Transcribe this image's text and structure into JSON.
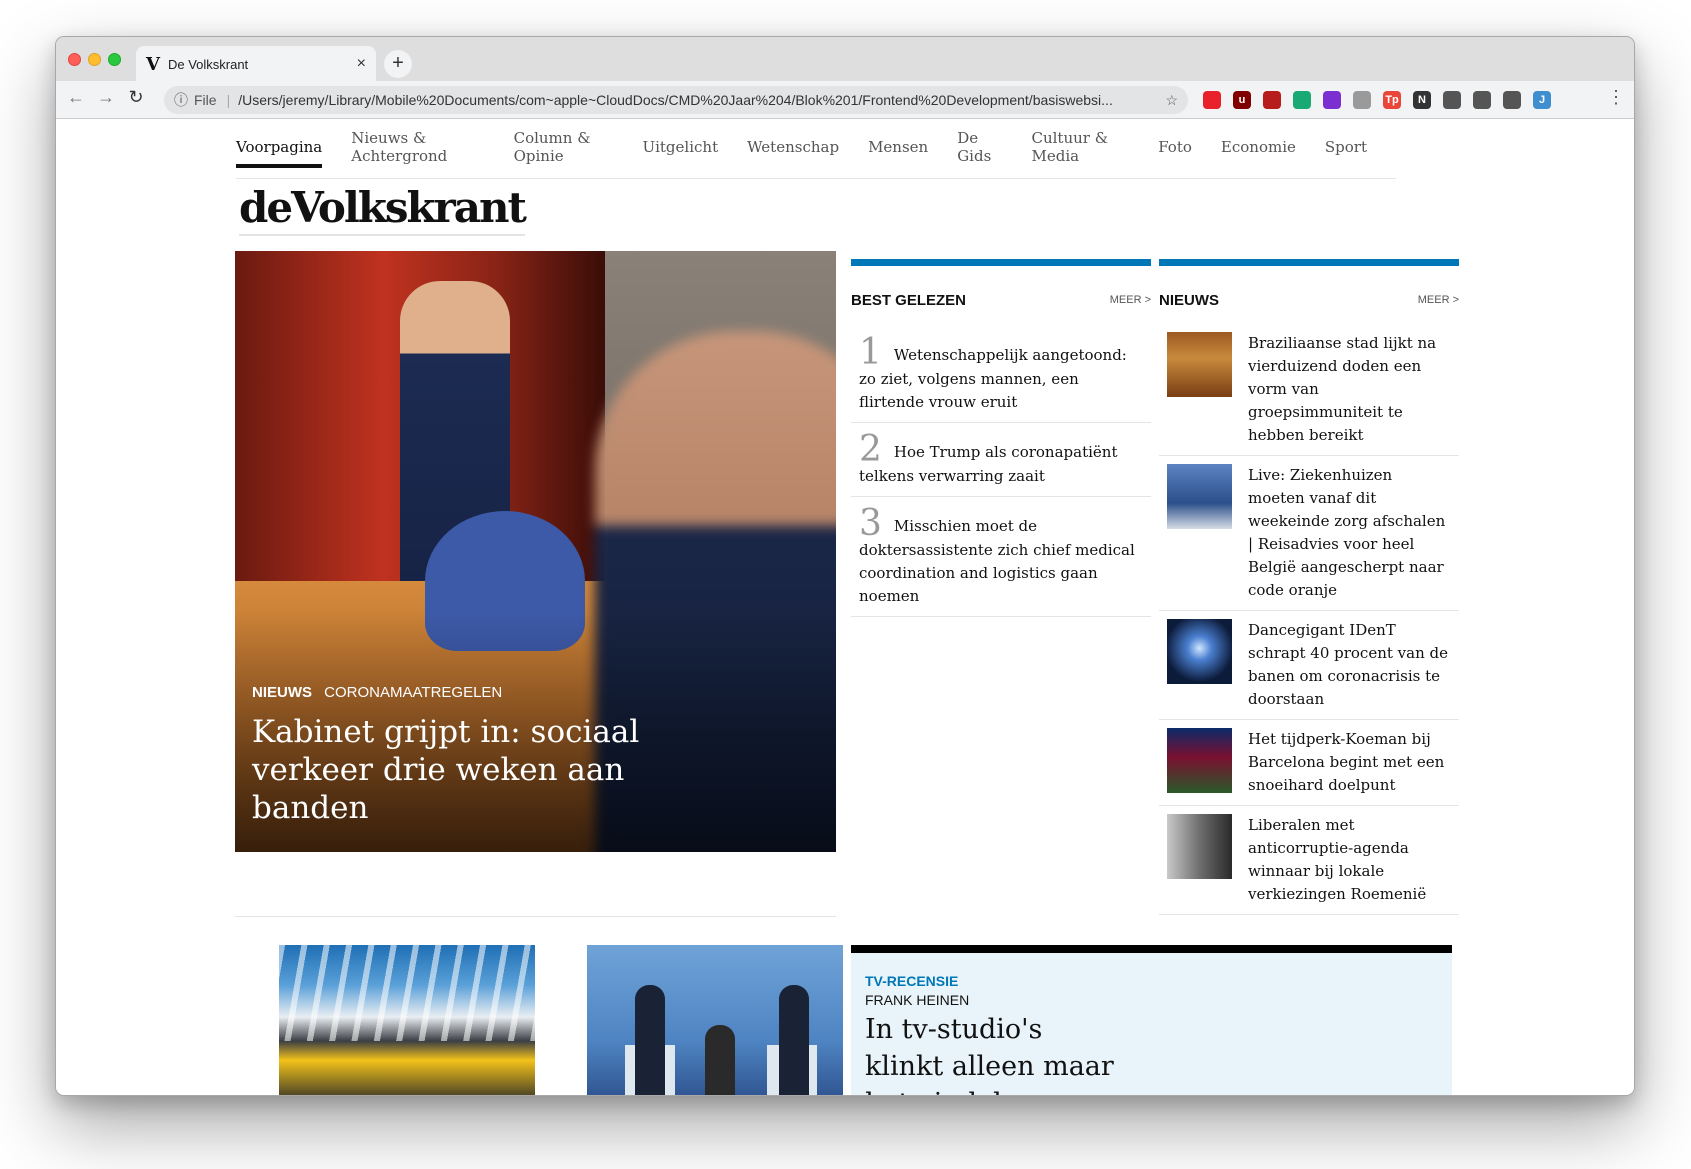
{
  "browser": {
    "tab_favicon": "V",
    "tab_title": "De Volkskrant",
    "tab_close": "×",
    "new_tab": "+",
    "back_icon": "←",
    "forward_icon": "→",
    "reload_icon": "↻",
    "info_icon": "ⓘ",
    "file_label": "File",
    "url": "/Users/jeremy/Library/Mobile%20Documents/com~apple~CloudDocs/CMD%20Jaar%204/Blok%201/Frontend%20Development/basiswebsi...",
    "star_icon": "☆",
    "menu_icon": "⋮",
    "extension_icons": [
      {
        "glyph": "",
        "color": "#e8212b"
      },
      {
        "glyph": "u",
        "color": "#800000"
      },
      {
        "glyph": "",
        "color": "#b71d1d"
      },
      {
        "glyph": "",
        "color": "#19a974"
      },
      {
        "glyph": "",
        "color": "#7b2fd0"
      },
      {
        "glyph": "",
        "color": "#9a9a9a"
      },
      {
        "glyph": "Tp",
        "color": "#e8463a"
      },
      {
        "glyph": "N",
        "color": "#333333"
      },
      {
        "glyph": "",
        "color": "#555555"
      },
      {
        "glyph": "",
        "color": "#555555"
      },
      {
        "glyph": "",
        "color": "#555555"
      },
      {
        "glyph": "J",
        "color": "#3e8ed0"
      }
    ]
  },
  "site": {
    "nav": [
      "Voorpagina",
      "Nieuws & Achtergrond",
      "Column & Opinie",
      "Uitgelicht",
      "Wetenschap",
      "Mensen",
      "De Gids",
      "Cultuur & Media",
      "Foto",
      "Economie",
      "Sport"
    ],
    "logo": "deVolkskrant",
    "hero": {
      "tag1": "NIEUWS",
      "tag2": "CORONAMAATREGELEN",
      "headline": "Kabinet grijpt in: sociaal verkeer drie weken aan banden"
    },
    "best_gelezen": {
      "title": "BEST GELEZEN",
      "more": "MEER >",
      "items": [
        {
          "num": "1",
          "text": "Wetenschappelijk aangetoond: zo ziet, volgens mannen, een flirtende vrouw eruit"
        },
        {
          "num": "2",
          "text": "Hoe Trump als coronapatiënt telkens verwarring zaait"
        },
        {
          "num": "3",
          "text": "Misschien moet de doktersassistente zich chief medical coordination and logistics gaan noemen"
        }
      ]
    },
    "nieuws": {
      "title": "NIEUWS",
      "more": "MEER >",
      "items": [
        {
          "text": "Braziliaanse stad lijkt na vierduizend doden een vorm van groepsimmuniteit te hebben bereikt"
        },
        {
          "text": "Live: Ziekenhuizen moeten vanaf dit weekeinde zorg afschalen | Reisadvies voor heel België aangescherpt naar code oranje"
        },
        {
          "text": "Dancegigant IDenT schrapt 40 procent van de banen om coronacrisis te doorstaan"
        },
        {
          "text": "Het tijdperk-Koeman bij Barcelona begint met een snoeihard doelpunt"
        },
        {
          "text": "Liberalen met anticorruptie-agenda winnaar bij lokale verkiezingen Roemenië"
        }
      ]
    },
    "review": {
      "kicker": "TV-RECENSIE",
      "author": "FRANK HEINEN",
      "title": "In tv-studio's klinkt alleen maar het eindeloze"
    }
  }
}
